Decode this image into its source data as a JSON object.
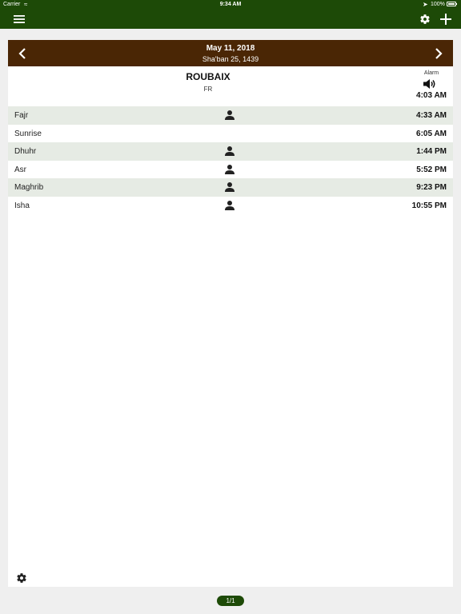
{
  "status_bar": {
    "carrier": "Carrier",
    "time": "9:34 AM",
    "battery": "100%"
  },
  "nav": {
    "icons": [
      "menu-icon",
      "gear-icon",
      "plus-icon"
    ],
    "color": "#1d4a07"
  },
  "date": {
    "gregorian": "May 11, 2018",
    "hijri": "Sha'ban 25, 1439",
    "header_color": "#4a2605"
  },
  "location": {
    "city": "ROUBAIX",
    "country": "FR"
  },
  "alarm": {
    "label": "Alarm",
    "time": "4:03 AM"
  },
  "prayers": [
    {
      "name": "Fajr",
      "time": "4:33 AM",
      "has_person": true
    },
    {
      "name": "Sunrise",
      "time": "6:05 AM",
      "has_person": false
    },
    {
      "name": "Dhuhr",
      "time": "1:44 PM",
      "has_person": true
    },
    {
      "name": "Asr",
      "time": "5:52 PM",
      "has_person": true
    },
    {
      "name": "Maghrib",
      "time": "9:23 PM",
      "has_person": true
    },
    {
      "name": "Isha",
      "time": "10:55 PM",
      "has_person": true
    }
  ],
  "pagination": {
    "label": "1/1"
  }
}
